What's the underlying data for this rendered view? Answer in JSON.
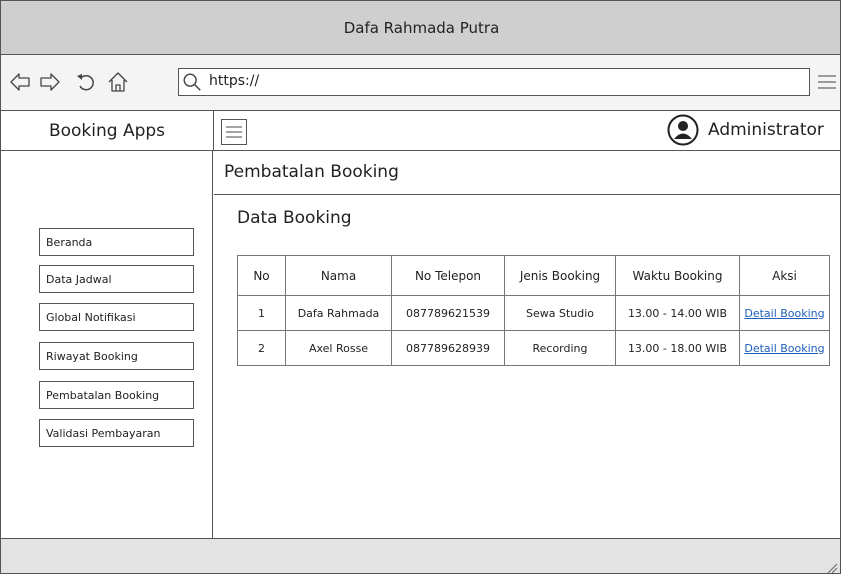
{
  "window": {
    "title": "Dafa Rahmada Putra"
  },
  "browser": {
    "url": "https://",
    "icons": [
      "back-arrow-icon",
      "forward-arrow-icon",
      "reload-icon",
      "home-icon",
      "search-icon",
      "hamburger-menu-icon"
    ]
  },
  "app": {
    "name": "Booking Apps"
  },
  "topbar": {
    "user_label": "Administrator"
  },
  "sidebar": {
    "items": [
      {
        "label": "Beranda"
      },
      {
        "label": "Data Jadwal"
      },
      {
        "label": "Global Notifikasi"
      },
      {
        "label": "Riwayat Booking"
      },
      {
        "label": "Pembatalan Booking"
      },
      {
        "label": "Validasi Pembayaran"
      }
    ]
  },
  "main": {
    "page_title": "Pembatalan Booking",
    "section_title": "Data Booking",
    "table": {
      "headers": [
        "No",
        "Nama",
        "No Telepon",
        "Jenis Booking",
        "Waktu Booking",
        "Aksi"
      ],
      "rows": [
        {
          "no": "1",
          "nama": "Dafa Rahmada",
          "telepon": "087789621539",
          "jenis": "Sewa Studio",
          "waktu": "13.00 - 14.00 WIB",
          "aksi": "Detail Booking"
        },
        {
          "no": "2",
          "nama": "Axel Rosse",
          "telepon": "087789628939",
          "jenis": "Recording",
          "waktu": "13.00 - 18.00 WIB",
          "aksi": "Detail Booking"
        }
      ]
    }
  },
  "colors": {
    "titlebar": "#cfcfcf",
    "link": "#1f5fbf",
    "border": "#555555",
    "footer": "#e3e3e3"
  }
}
